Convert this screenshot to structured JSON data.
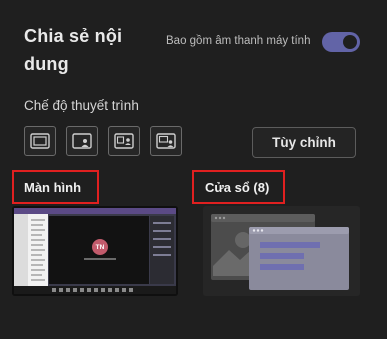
{
  "panel": {
    "title": "Chia sẻ nội dung",
    "include_system_audio": "Bao gồm âm thanh máy tính",
    "include_system_audio_on": true,
    "presenter_mode_label": "Chế độ thuyết trình",
    "presenter_modes": [
      "content-only-icon",
      "standout-icon",
      "side-by-side-icon",
      "reporter-icon"
    ],
    "customize_button": "Tùy chỉnh"
  },
  "sections": {
    "screen_label": "Màn hình",
    "window_label": "Cửa sổ (8)"
  },
  "screen_thumb": {
    "avatar_initials": "TN"
  },
  "colors": {
    "accent": "#6264a7",
    "highlight": "#e02020",
    "background": "#1f1f1f"
  }
}
